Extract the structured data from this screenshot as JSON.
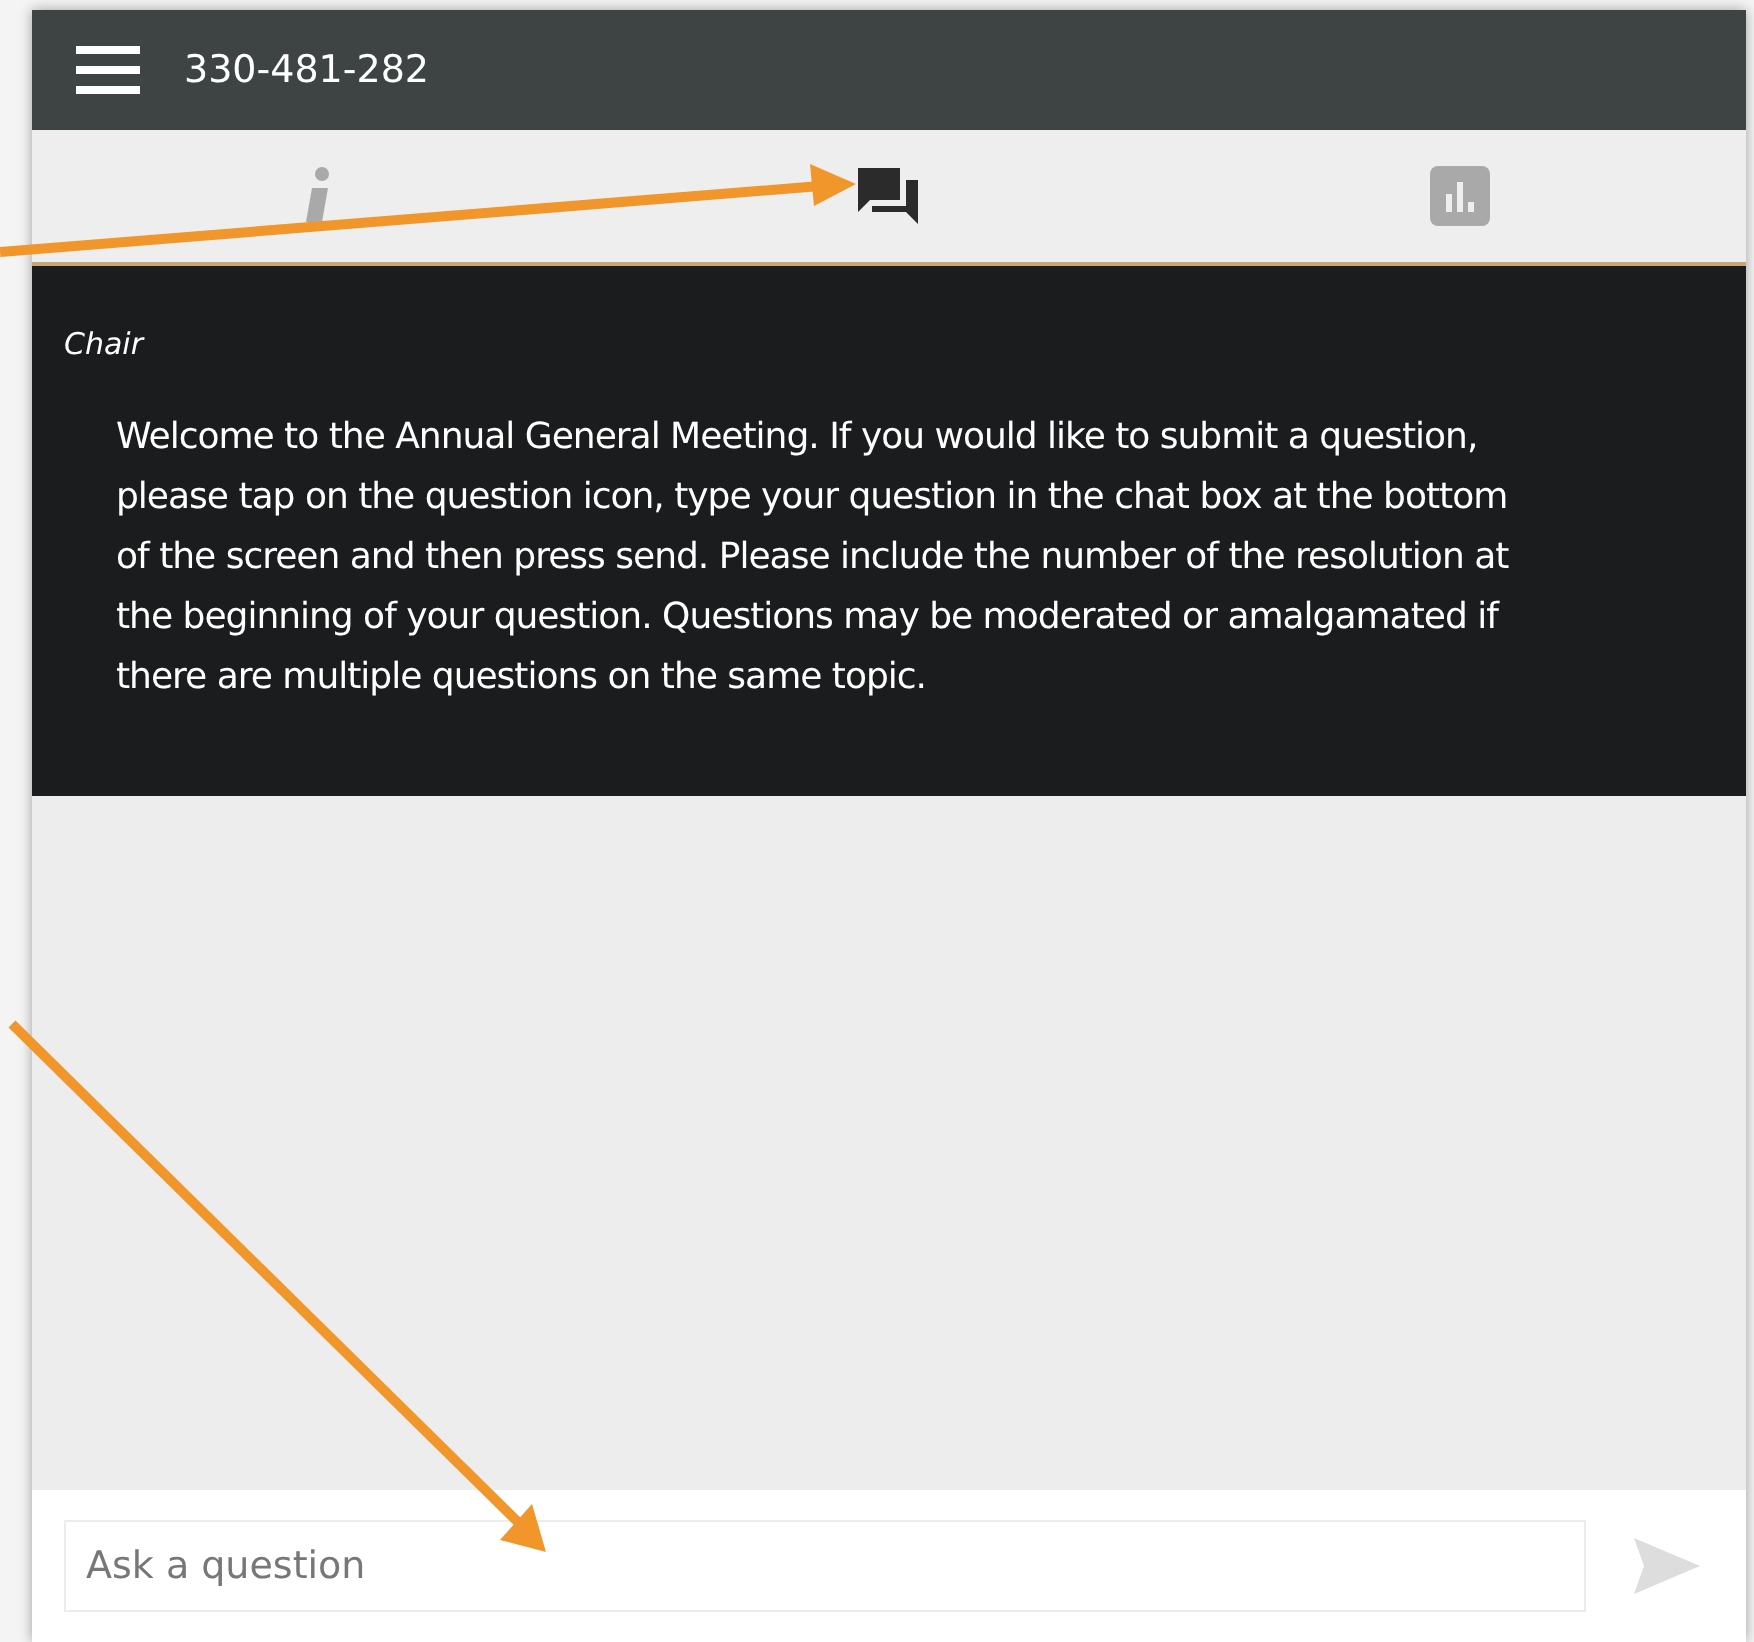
{
  "header": {
    "title": "330-481-282"
  },
  "tabs": [
    {
      "kind": "info",
      "selected": false
    },
    {
      "kind": "chat",
      "selected": true
    },
    {
      "kind": "poll",
      "selected": false
    }
  ],
  "messages": [
    {
      "sender": "Chair",
      "text": "Welcome to the Annual General Meeting. If you would like to submit a question, please tap on the question icon, type your question in the chat box at the bottom of the screen and then press send. Please include the number of the resolution at the beginning of your question. Questions may be moderated or amalgamated if there are multiple questions on the same topic."
    }
  ],
  "composer": {
    "placeholder": "Ask a question"
  }
}
